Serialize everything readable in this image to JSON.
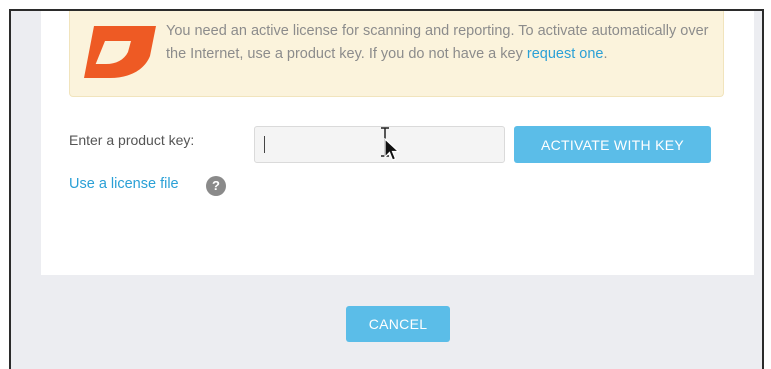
{
  "notice": {
    "text": "You need an active license for scanning and reporting. To activate automatically over the Internet, use a product key. If you do not have a key",
    "link_text": "request one",
    "suffix": "."
  },
  "form": {
    "product_key_label": "Enter a product key:",
    "product_key_value": "",
    "activate_label": "ACTIVATE WITH KEY",
    "license_file_link": "Use a license file",
    "help_glyph": "?"
  },
  "footer": {
    "cancel_label": "CANCEL"
  },
  "icons": {
    "logo": "brand-logo-icon",
    "help": "help-icon",
    "pointer": "mouse-pointer-icon"
  },
  "colors": {
    "accent": "#5bbde8",
    "link": "#2aa0d6",
    "notice_background": "#fbf3dc",
    "logo": "#ee5a24",
    "page_background": "#ecedf1"
  }
}
